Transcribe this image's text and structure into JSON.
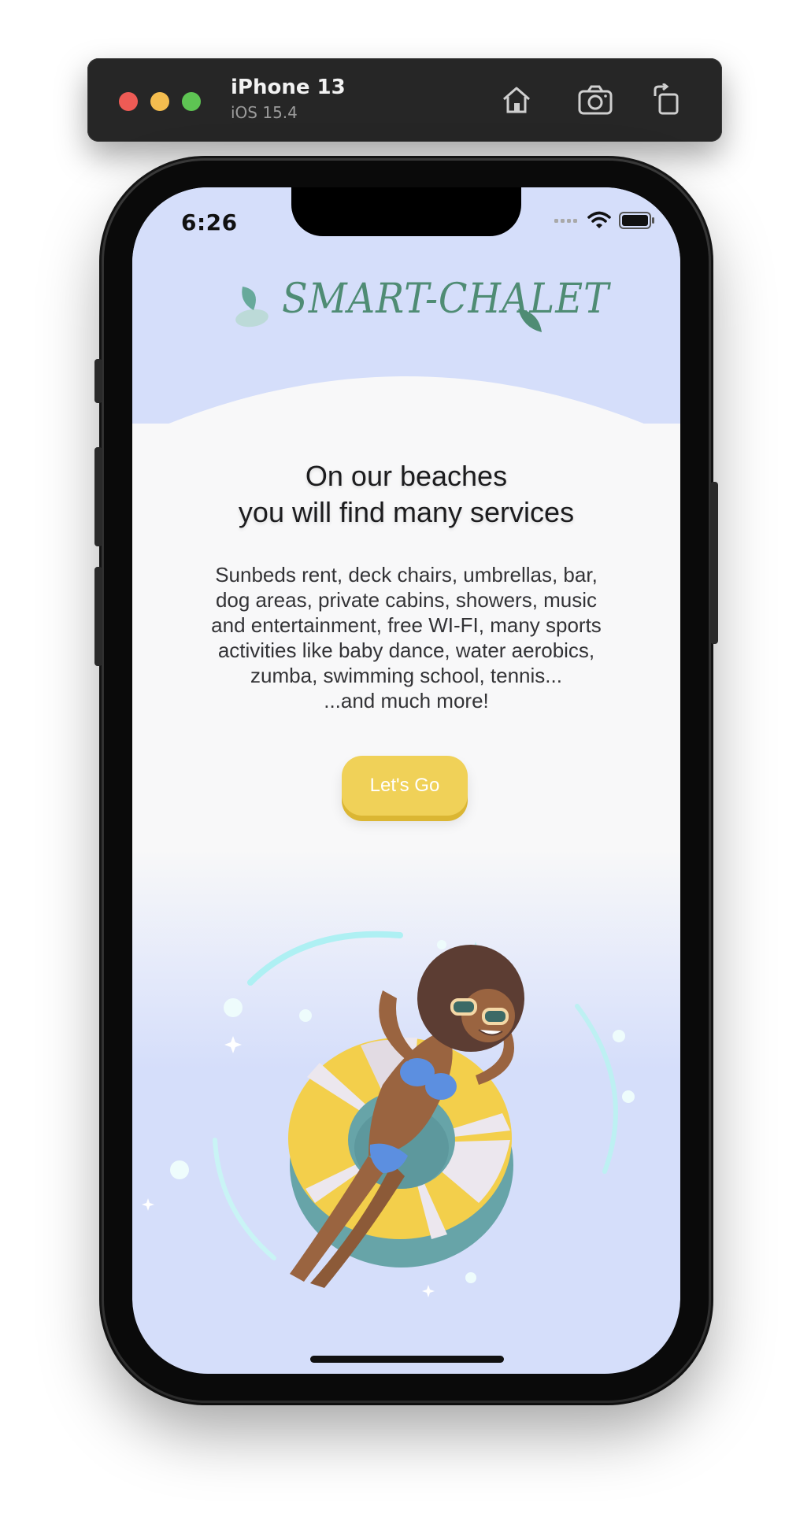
{
  "simulator": {
    "device_name": "iPhone 13",
    "os_version": "iOS 15.4",
    "buttons": {
      "home_icon": "home-icon",
      "screenshot_icon": "camera-icon",
      "rotate_icon": "rotate-icon"
    }
  },
  "status_bar": {
    "time": "6:26",
    "icons": [
      "signal-icon",
      "wifi-icon",
      "battery-icon"
    ]
  },
  "app": {
    "logo_text": "SMART-CHALET",
    "headline_line1": "On our beaches",
    "headline_line2": "you will find many services",
    "description_lines": [
      "Sunbeds rent, deck chairs, umbrellas, bar,",
      "dog areas, private cabins, showers, music",
      "and entertainment, free WI-FI, many sports",
      "activities like baby dance, water aerobics,",
      "zumba, swimming school, tennis...",
      "...and much more!"
    ],
    "cta_label": "Let's Go"
  },
  "colors": {
    "background_top": "#d5defa",
    "background_mid": "#f8f8f9",
    "logo": "#4f8c74",
    "cta": "#f0d158",
    "toolbar": "#262626"
  }
}
